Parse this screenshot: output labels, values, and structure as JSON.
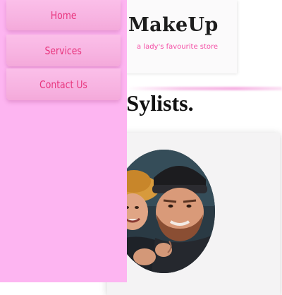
{
  "brand": {
    "title": "MakeUp",
    "tagline": "a lady's favourite store"
  },
  "nav": {
    "items": [
      {
        "label": "Home"
      },
      {
        "label": "Services"
      },
      {
        "label": "Contact Us"
      }
    ]
  },
  "stylists": {
    "heading_visible": "ur Sylists."
  },
  "colors": {
    "drawer_bg": "#fdb5f1",
    "nav_text": "#e8357d",
    "tagline": "#f44fa6"
  }
}
